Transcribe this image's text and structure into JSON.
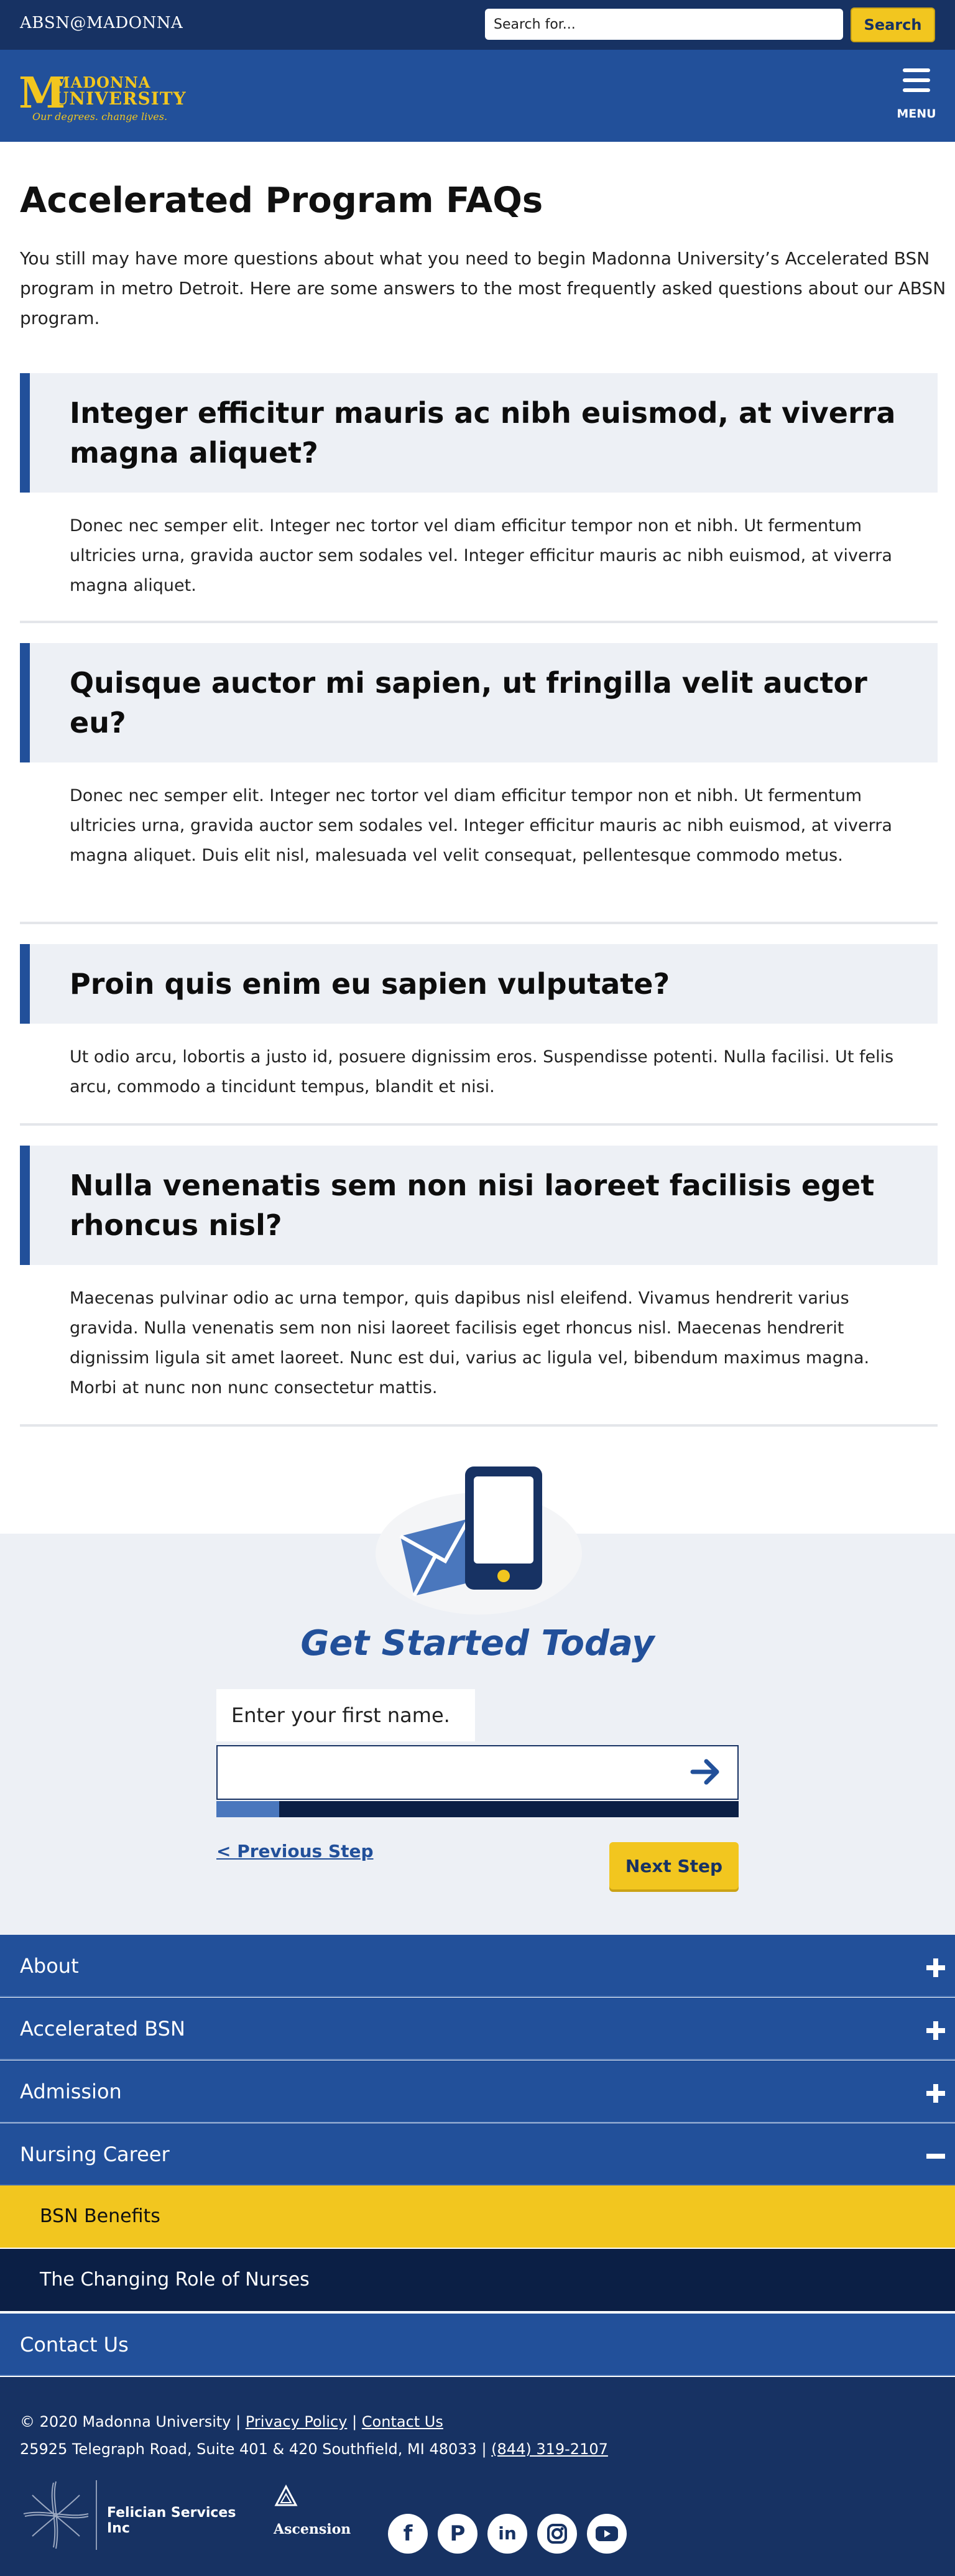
{
  "topbar": {
    "brand": "ABSN@MADONNA",
    "search_placeholder": "Search for...",
    "search_button": "Search"
  },
  "header": {
    "logo": {
      "name_line1": "MADONNA",
      "name_line2": "UNIVERSITY",
      "tagline": "Our degrees. change lives."
    },
    "menu_label": "MENU",
    "menu_icon": "hamburger-icon"
  },
  "main": {
    "title": "Accelerated Program FAQs",
    "intro": "You still may have more questions about what you need to begin Madonna University’s Accelerated BSN program in metro Detroit. Here are some answers to the most frequently asked questions about our ABSN program.",
    "faqs": [
      {
        "question": "Integer efficitur mauris ac nibh euismod, at viverra magna aliquet?",
        "answer": "Donec nec semper elit. Integer nec tortor vel diam efficitur tempor non et nibh. Ut fermentum ultricies urna, gravida auctor sem sodales vel. Integer efficitur mauris ac nibh euismod, at viverra magna aliquet."
      },
      {
        "question": "Quisque auctor mi sapien, ut fringilla velit auctor eu?",
        "answer": "Donec nec semper elit. Integer nec tortor vel diam efficitur tempor non et nibh. Ut fermentum ultricies urna, gravida auctor sem sodales vel. Integer efficitur mauris ac nibh euismod, at viverra magna aliquet. Duis elit nisl, malesuada vel velit consequat, pellentesque commodo metus."
      },
      {
        "question": "Proin quis enim eu sapien vulputate?",
        "answer": "Ut odio arcu, lobortis a justo id, posuere dignissim eros. Suspendisse potenti. Nulla facilisi. Ut felis arcu, commodo a tincidunt tempus, blandit et nisi."
      },
      {
        "question": "Nulla venenatis sem non nisi laoreet facilisis eget rhoncus nisl?",
        "answer": "Maecenas pulvinar odio ac urna tempor, quis dapibus nisl eleifend. Vivamus hendrerit varius gravida. Nulla venenatis sem non nisi laoreet facilisis eget rhoncus nisl. Maecenas hendrerit dignissim ligula sit amet laoreet. Nunc est dui, varius ac ligula vel, bibendum maximus magna. Morbi at nunc non nunc consectetur mattis."
      }
    ]
  },
  "get_started": {
    "title": "Get Started Today",
    "first_name_label": "Enter your first name.",
    "first_name_value": "",
    "progress": 0.12,
    "previous_step": "< Previous Step",
    "next_step": "Next Step",
    "icons": [
      "envelope-icon",
      "phone-icon",
      "arrow-right-icon"
    ]
  },
  "nav_accordion": [
    {
      "label": "About",
      "state": "collapsed"
    },
    {
      "label": "Accelerated BSN",
      "state": "collapsed"
    },
    {
      "label": "Admission",
      "state": "collapsed"
    },
    {
      "label": "Nursing Career",
      "state": "expanded"
    }
  ],
  "nav_sub": [
    {
      "label": "BSN Benefits",
      "active": true
    },
    {
      "label": "The Changing Role of Nurses",
      "active": false
    }
  ],
  "nav_contact": "Contact Us",
  "footer": {
    "copyright": "© 2020 Madonna University |",
    "privacy": "Privacy Policy",
    "sep": "|",
    "contact": "Contact Us",
    "address": "25925 Telegraph Road, Suite 401 & 420 Southfield, MI 48033 |",
    "phone": "(844) 319-2107",
    "felician": "Felician Services Inc",
    "ascension": "Ascension",
    "social": [
      "facebook-icon",
      "pinterest-icon",
      "linkedin-icon",
      "instagram-icon",
      "youtube-icon"
    ]
  },
  "colors": {
    "navy": "#173263",
    "blue": "#22509a",
    "gold": "#f2c61f",
    "panel": "#edf0f5",
    "dark": "#0b1f45"
  }
}
